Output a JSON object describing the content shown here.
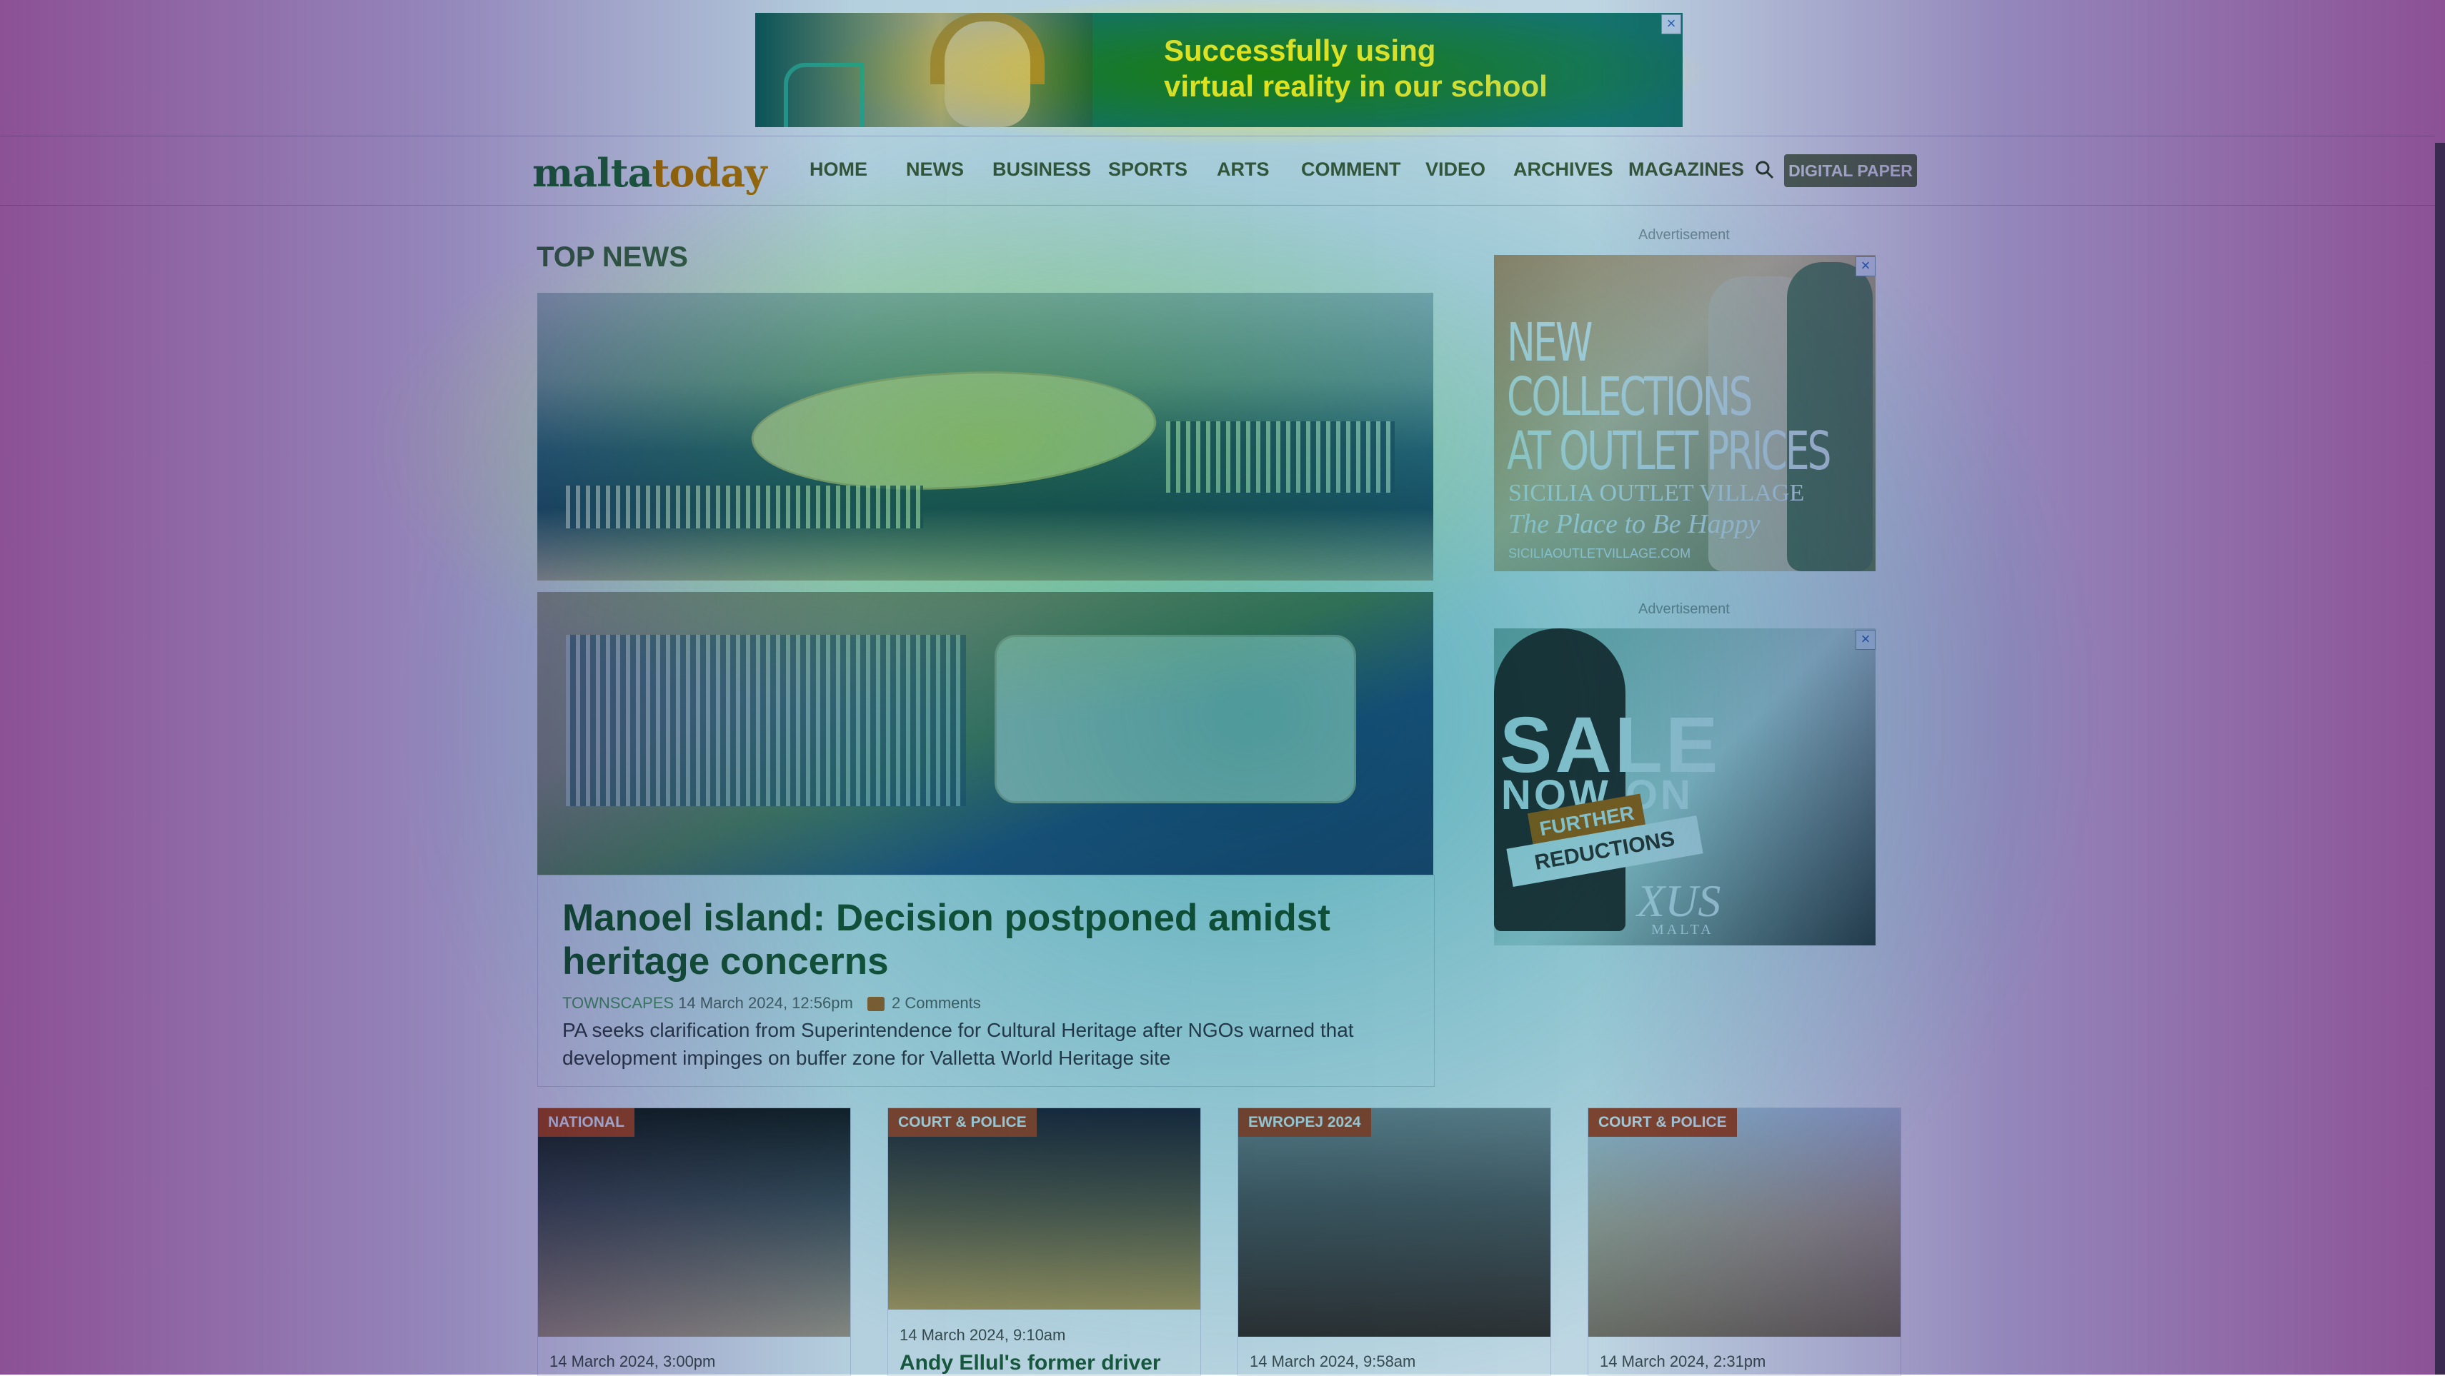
{
  "top_ad": {
    "text_line1": "Successfully using",
    "text_line2": "virtual reality in our school",
    "close_icon": "close-icon"
  },
  "brand": {
    "logo_part1": "malta",
    "logo_part2": "today"
  },
  "nav": {
    "items": [
      "HOME",
      "NEWS",
      "BUSINESS",
      "SPORTS",
      "ARTS",
      "COMMENT",
      "VIDEO",
      "ARCHIVES",
      "MAGAZINES"
    ],
    "search_icon": "search-icon",
    "digital_paper": "DIGITAL PAPER"
  },
  "main": {
    "section_title": "TOP NEWS",
    "lead": {
      "headline": "Manoel island: Decision postponed amidst heritage concerns",
      "category": "TOWNSCAPES",
      "date": "14 March 2024, 12:56pm",
      "comments": "2 Comments",
      "standfirst": "PA seeks clarification from Superintendence for Cultural Heritage after NGOs warned that development impinges on buffer zone for Valletta World Heritage site"
    }
  },
  "sidebar": {
    "ad_label": "Advertisement",
    "ad1": {
      "line1": "NEW",
      "line2": "COLLECTIONS",
      "line3": "AT OUTLET PRICES",
      "brand": "SICILIA OUTLET VILLAGE",
      "tagline": "The Place to Be Happy",
      "url": "SICILIAOUTLETVILLAGE.COM"
    },
    "ad2": {
      "sale": "SALE",
      "now_on": "NOW ON",
      "further": "FURTHER",
      "reductions": "REDUCTIONS",
      "brand": "XUS",
      "brand_sub": "MALTA"
    }
  },
  "cards": [
    {
      "badge": "NATIONAL",
      "date": "14 March 2024, 3:00pm",
      "title": ""
    },
    {
      "badge": "COURT & POLICE",
      "date": "14 March 2024, 9:10am",
      "title": "Andy Ellul's former driver"
    },
    {
      "badge": "EWROPEJ 2024",
      "date": "14 March 2024, 9:58am",
      "title": ""
    },
    {
      "badge": "COURT & POLICE",
      "date": "14 March 2024, 2:31pm",
      "title": ""
    }
  ],
  "colors": {
    "brand_green": "#2a7c4f",
    "brand_orange": "#d88a10",
    "badge_red": "#c2553a",
    "headline_green": "#1f6a46"
  }
}
